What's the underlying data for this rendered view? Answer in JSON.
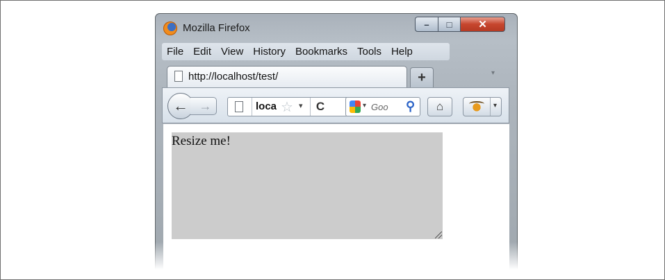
{
  "window": {
    "title": "Mozilla Firefox",
    "buttons": {
      "minimize": "–",
      "maximize": "□",
      "close": "✕"
    }
  },
  "menubar": {
    "items": [
      "File",
      "Edit",
      "View",
      "History",
      "Bookmarks",
      "Tools",
      "Help"
    ]
  },
  "tabs": {
    "active_title": "http://localhost/test/",
    "new_tab_label": "+"
  },
  "navbar": {
    "url_value": "loca",
    "search_placeholder": "Goo",
    "icons": [
      "back-icon",
      "forward-icon",
      "page-icon",
      "star-icon",
      "reload-icon",
      "google-icon",
      "search-icon",
      "home-icon",
      "firebug-icon"
    ]
  },
  "content": {
    "resizable_text": "Resize me!"
  },
  "colors": {
    "resizable_bg": "#cccccc",
    "close_button": "#c6462e"
  }
}
